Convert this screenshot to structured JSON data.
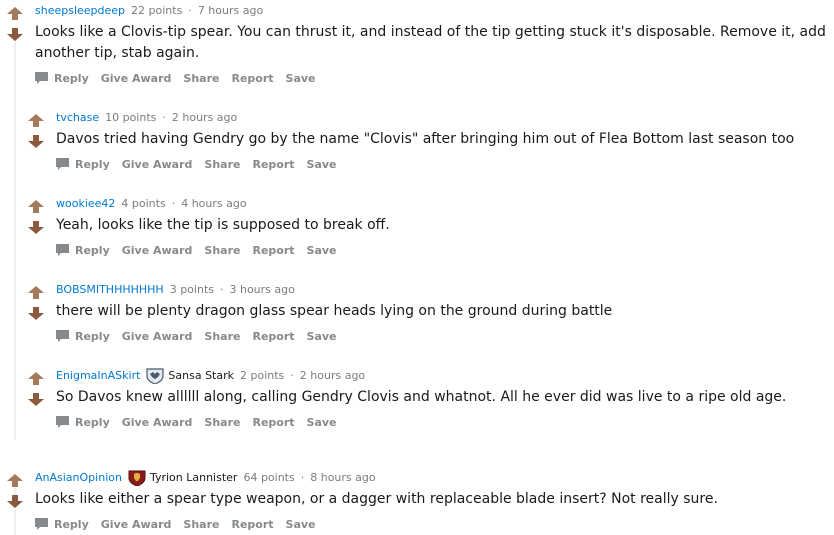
{
  "actions": {
    "reply": "Reply",
    "give_award": "Give Award",
    "share": "Share",
    "report": "Report",
    "save": "Save"
  },
  "comments": [
    {
      "author": "sheepsleepdeep",
      "points": "22 points",
      "separator": "·",
      "time": "7 hours ago",
      "body": "Looks like a Clovis-tip spear. You can thrust it, and instead of the tip getting stuck it's disposable. Remove it, add another tip, stab again."
    },
    {
      "author": "tvchase",
      "points": "10 points",
      "separator": "·",
      "time": "2 hours ago",
      "body": "Davos tried having Gendry go by the name \"Clovis\" after bringing him out of Flea Bottom last season too"
    },
    {
      "author": "wookiee42",
      "points": "4 points",
      "separator": "·",
      "time": "4 hours ago",
      "body": "Yeah, looks like the tip is supposed to break off."
    },
    {
      "author": "BOBSMITHHHHHHH",
      "points": "3 points",
      "separator": "·",
      "time": "3 hours ago",
      "body": "there will be plenty dragon glass spear heads lying on the ground during battle"
    },
    {
      "author": "EnigmaInASkirt",
      "flair": "Sansa Stark",
      "flair_icon": "direwolf-sigil-icon",
      "points": "2 points",
      "separator": "·",
      "time": "2 hours ago",
      "body": "So Davos knew allllll along, calling Gendry Clovis and whatnot. All he ever did was live to a ripe old age."
    },
    {
      "author": "AnAsianOpinion",
      "flair": "Tyrion Lannister",
      "flair_icon": "lannister-lion-icon",
      "points": "64 points",
      "separator": "·",
      "time": "8 hours ago",
      "body": "Looks like either a spear type weapon, or a dagger with replaceable blade insert? Not really sure."
    }
  ],
  "colors": {
    "upvote": "#a57a5a",
    "downvote": "#8b5a3c",
    "author_link": "#0079d3",
    "meta_text": "#7c7c7c",
    "action_text": "#878a8c",
    "thread_line": "#edeff1"
  }
}
